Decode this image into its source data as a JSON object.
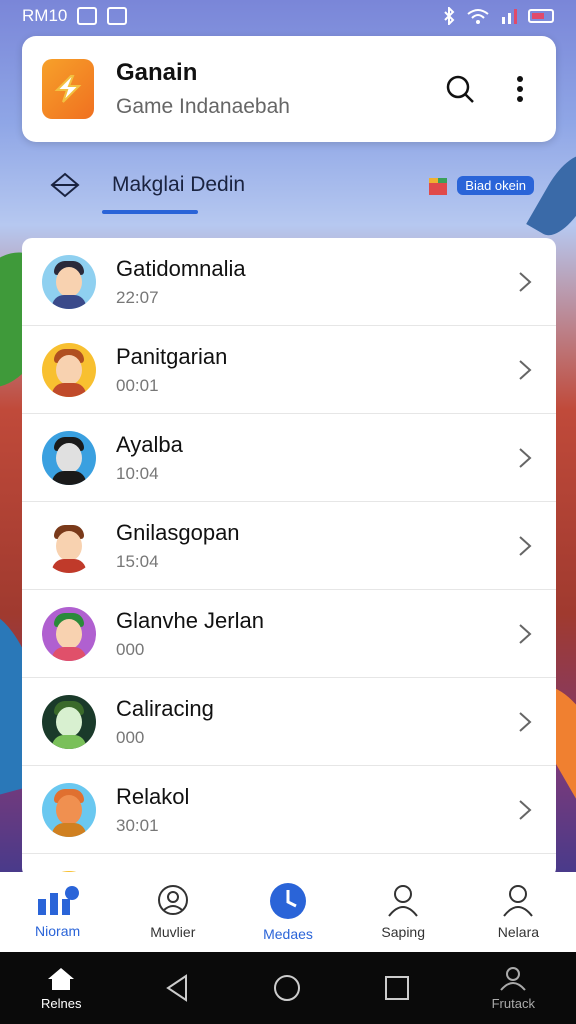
{
  "status_bar": {
    "carrier": "RM10"
  },
  "header": {
    "title": "Ganain",
    "subtitle": "Game Indanaebah"
  },
  "tab_row": {
    "label": "Makglai Dedin",
    "badge": "Biad okein"
  },
  "list": [
    {
      "name": "Gatidomnalia",
      "time": "22:07",
      "avatar_color": "#8fd0f0",
      "hair": "#2a2a3a",
      "shirt": "#3a4a8a"
    },
    {
      "name": "Panitgarian",
      "time": "00:01",
      "avatar_color": "#f8c030",
      "hair": "#b05020",
      "shirt": "#c04a2a"
    },
    {
      "name": "Ayalba",
      "time": "10:04",
      "avatar_color": "#3aa0e0",
      "hair": "#1a1a1a",
      "shirt": "#e0e0e0"
    },
    {
      "name": "Gnilasgopan",
      "time": "15:04",
      "avatar_color": "#ffffff",
      "hair": "#7a3a1a",
      "shirt": "#c03a2a"
    },
    {
      "name": "Glanvhe Jerlan",
      "time": "000",
      "avatar_color": "#b060d0",
      "hair": "#2a8a3a",
      "shirt": "#e0506a"
    },
    {
      "name": "Caliracing",
      "time": "000",
      "avatar_color": "#1a3a2a",
      "hair": "#3a6a2a",
      "shirt": "#7ac05a"
    },
    {
      "name": "Relakol",
      "time": "30:01",
      "avatar_color": "#6ac8f0",
      "hair": "#e07030",
      "shirt": "#d08020"
    },
    {
      "name": "",
      "time": "",
      "avatar_color": "#f8c030",
      "hair": "#b05020",
      "shirt": "#c04a2a"
    }
  ],
  "bottom_nav": [
    {
      "label": "Nioram",
      "active": true
    },
    {
      "label": "Muvlier",
      "active": false
    },
    {
      "label": "Medaes",
      "active": true
    },
    {
      "label": "Saping",
      "active": false
    },
    {
      "label": "Nelara",
      "active": false
    }
  ],
  "system_bar": {
    "home_label": "Relnes",
    "right_label": "Frutack"
  },
  "colors": {
    "accent": "#2a64d8",
    "logo": "#f07020"
  }
}
